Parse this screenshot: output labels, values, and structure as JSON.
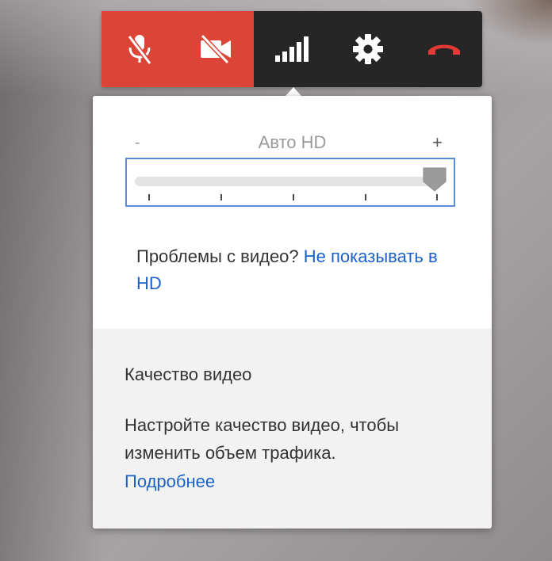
{
  "toolbar": {
    "buttons": [
      {
        "name": "mic-muted",
        "icon": "mic-off-icon",
        "state": "off"
      },
      {
        "name": "camera-off",
        "icon": "video-off-icon",
        "state": "off"
      },
      {
        "name": "bandwidth",
        "icon": "signal-bars-icon"
      },
      {
        "name": "settings",
        "icon": "gear-icon"
      },
      {
        "name": "hang-up",
        "icon": "end-call-icon"
      }
    ],
    "colors": {
      "muted_bg": "#db4437",
      "bar_bg": "#262626",
      "hangup": "#e53935"
    }
  },
  "quality": {
    "minus": "-",
    "label": "Авто HD",
    "plus": "+",
    "slider_steps": 5,
    "slider_value_step": 5
  },
  "problem": {
    "text": "Проблемы с видео?",
    "link": "Не показывать в HD"
  },
  "info": {
    "title": "Качество видео",
    "text": "Настройте качество видео, чтобы изменить объем трафика.",
    "link": "Подробнее"
  },
  "colors": {
    "link": "#1a62c9",
    "slider_focus": "#5b8ed6"
  }
}
